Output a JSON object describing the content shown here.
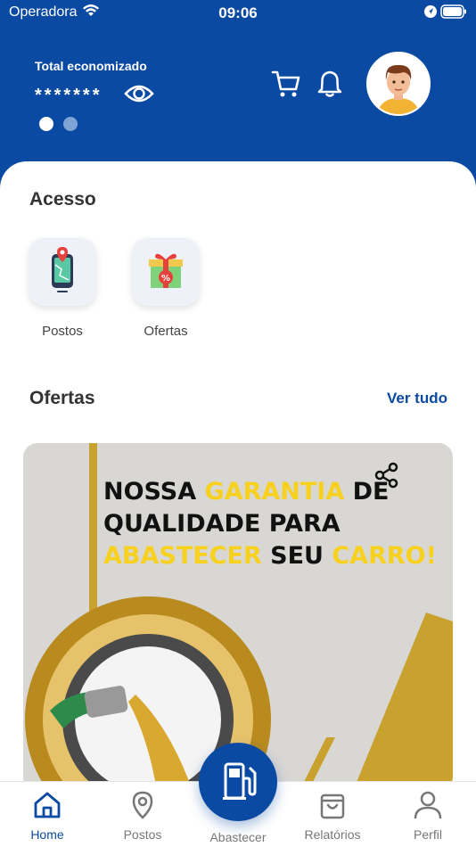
{
  "status_bar": {
    "carrier": "Operadora",
    "time": "09:06"
  },
  "header": {
    "total_label": "Total economizado",
    "total_value": "*******",
    "carousel_dots": 2
  },
  "acesso": {
    "title": "Acesso",
    "items": [
      {
        "label": "Postos",
        "icon": "map-phone-icon"
      },
      {
        "label": "Ofertas",
        "icon": "gift-discount-icon"
      }
    ]
  },
  "ofertas": {
    "title": "Ofertas",
    "see_all": "Ver tudo",
    "banner": {
      "line1_a": "NOSSA ",
      "line1_b": "GARANTIA",
      "line1_c": " DE",
      "line2": "QUALIDADE PARA",
      "line3_a": "ABASTECER",
      "line3_b": " SEU ",
      "line3_c": "CARRO!"
    }
  },
  "tabbar": {
    "items": [
      {
        "label": "Home",
        "active": true
      },
      {
        "label": "Postos"
      },
      {
        "label": "Abastecer"
      },
      {
        "label": "Relatórios"
      },
      {
        "label": "Perfil"
      }
    ]
  },
  "colors": {
    "primary": "#0b4aa2",
    "highlight": "#f7d11e",
    "background": "#ffffff"
  }
}
